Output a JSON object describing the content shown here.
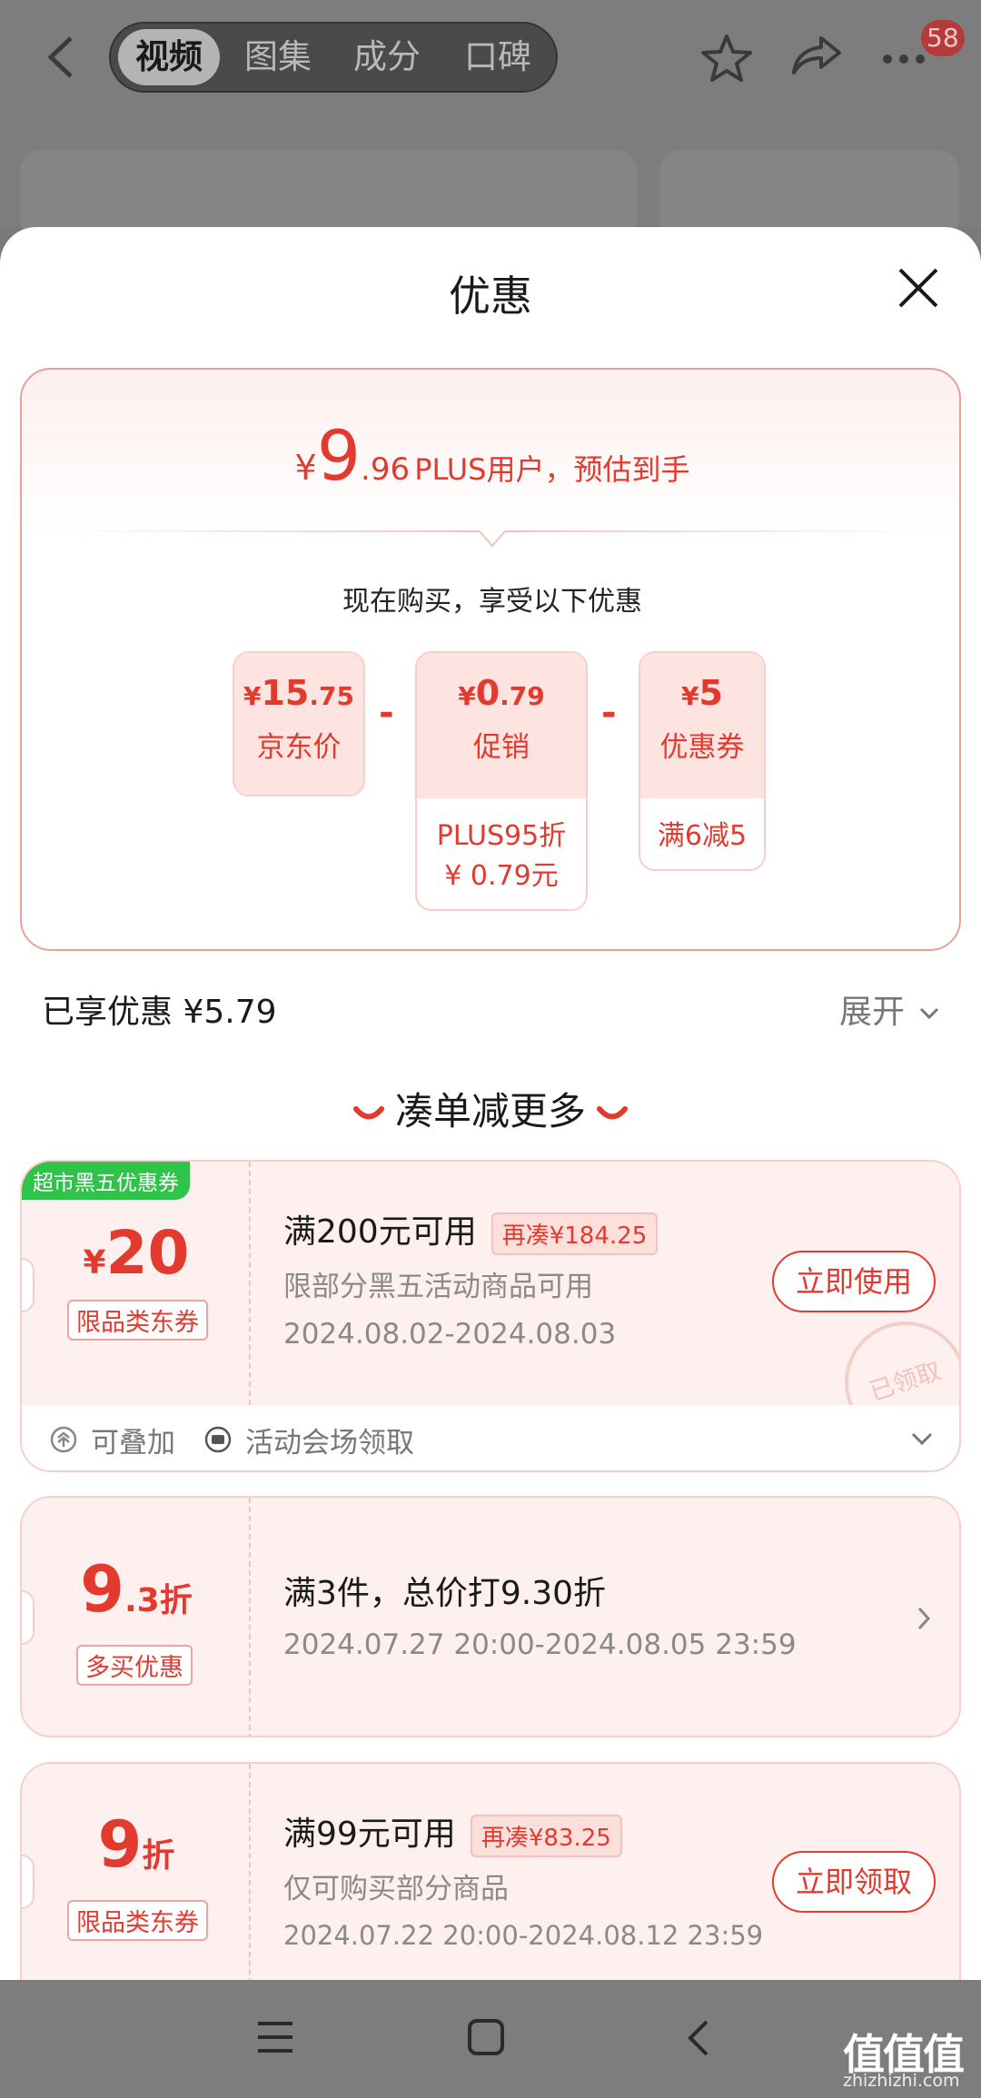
{
  "topbar": {
    "tabs": [
      "视频",
      "图集",
      "成分",
      "口碑"
    ],
    "active_tab": 0,
    "badge": "58"
  },
  "sheet": {
    "title": "优惠",
    "estimate": {
      "currency": "¥",
      "integer": "9",
      "decimal": ".96",
      "label": "PLUS用户，预估到手"
    },
    "now_buy": "现在购买，享受以下优惠",
    "price_cards": [
      {
        "currency": "¥",
        "int": "15",
        "dec": ".75",
        "label": "京东价"
      },
      {
        "currency": "¥",
        "int": "0",
        "dec": ".79",
        "label": "促销",
        "detail1": "PLUS95折",
        "detail2": "¥ 0.79元"
      },
      {
        "currency": "¥",
        "int": "5",
        "dec": "",
        "label": "优惠券",
        "detail1": "满6减5"
      }
    ],
    "minus_sign": "-",
    "saved": "已享优惠 ¥5.79",
    "expand": "展开",
    "more_title": "凑单减更多",
    "coupons": [
      {
        "ribbon": "超市黑五优惠券",
        "currency": "¥",
        "amount": "20",
        "unit": "",
        "tag": "限品类东券",
        "main": "满200元可用",
        "chip": "再凑¥184.25",
        "sub1": "限部分黑五活动商品可用",
        "sub2": "2024.08.02-2024.08.03",
        "button": "立即使用",
        "stamp": "已领取",
        "foot1": "可叠加",
        "foot2": "活动会场领取"
      },
      {
        "amount": "9",
        "decimal": ".3",
        "unit": "折",
        "tag": "多买优惠",
        "main": "满3件，总价打9.30折",
        "sub1": "2024.07.27 20:00-2024.08.05 23:59"
      },
      {
        "amount": "9",
        "unit": "折",
        "tag": "限品类东券",
        "main": "满99元可用",
        "chip": "再凑¥83.25",
        "sub1": "仅可购买部分商品",
        "sub2": "2024.07.22 20:00-2024.08.12 23:59",
        "button": "立即领取"
      }
    ]
  },
  "watermark": {
    "text": "值值值",
    "url": "zhizhizhi.com"
  },
  "colors": {
    "accent": "#e23a2e",
    "coupon_bg": "#fdf0ee",
    "ribbon": "#2fc34a"
  }
}
